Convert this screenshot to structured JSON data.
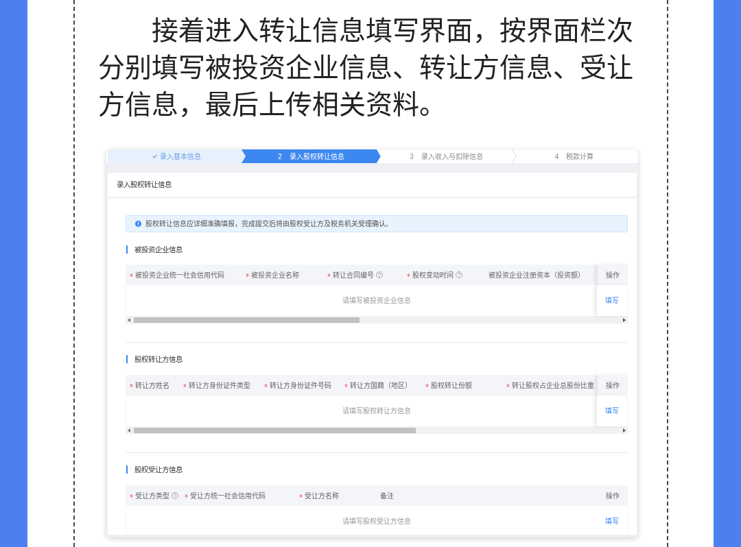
{
  "intro": "接着进入转让信息填写界面，按界面栏次分别填写被投资企业信息、转让方信息、受让方信息，最后上传相关资料。",
  "form_window": {
    "steps": [
      {
        "label": "录入基本信息",
        "completed": true,
        "selected": false
      },
      {
        "number": "2",
        "label": "录入股权转让信息",
        "completed": false,
        "selected": true
      },
      {
        "number": "3",
        "label": "录入收入与扣除信息",
        "completed": false,
        "selected": false
      },
      {
        "number": "4",
        "label": "税款计算",
        "completed": false,
        "selected": false
      }
    ],
    "panel_title": "录入股权转让信息",
    "alert": {
      "text": "股权转让信息应详细准确填报，完成提交后将由股权受让方及税务机关受理确认。"
    },
    "sections": [
      {
        "title": "被投资企业信息",
        "table": {
          "columns": [
            {
              "label": "被投资企业统一社会信用代码",
              "required": true
            },
            {
              "label": "被投资企业名称",
              "required": true
            },
            {
              "label": "转让合同编号",
              "required": true,
              "help": true
            },
            {
              "label": "股权变动时间",
              "required": true,
              "help": true
            },
            {
              "label": "被投资企业注册资本（投资额）"
            }
          ],
          "action_column": "操作",
          "empty_text": "请填写被投资企业信息",
          "action_link": "填写",
          "horizontal_scroll": true
        }
      },
      {
        "title": "股权转让方信息",
        "table": {
          "columns": [
            {
              "label": "转让方姓名",
              "required": true
            },
            {
              "label": "转让方身份证件类型",
              "required": true
            },
            {
              "label": "转让方身份证件号码",
              "required": true
            },
            {
              "label": "转让方国籍（地区）",
              "required": true
            },
            {
              "label": "股权转让份额",
              "required": true
            },
            {
              "label": "转让股权占企业总股份比重",
              "required": true
            }
          ],
          "action_column": "操作",
          "empty_text": "请填写股权转让方信息",
          "action_link": "填写",
          "horizontal_scroll": true
        }
      },
      {
        "title": "股权受让方信息",
        "table": {
          "columns": [
            {
              "label": "受让方类型",
              "required": true,
              "help": true
            },
            {
              "label": "受让方统一社会信用代码",
              "required": true
            },
            {
              "label": "受让方名称",
              "required": true
            },
            {
              "label": "备注"
            }
          ],
          "action_column": "操作",
          "empty_text": "请填写股权受让方信息",
          "action_link": "填写",
          "horizontal_scroll": false
        }
      }
    ]
  }
}
